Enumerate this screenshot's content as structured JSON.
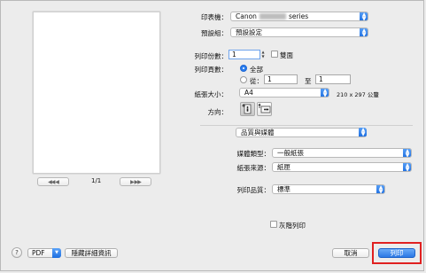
{
  "nav": {
    "prev_glyph": "◀◀ ◀",
    "next_glyph": "▶ ▶▶",
    "page_indicator": "1/1"
  },
  "printer": {
    "label": "印表機：",
    "value_prefix": "Canon",
    "value_suffix": "series"
  },
  "preset": {
    "label": "預設組：",
    "value": "預設設定"
  },
  "copies": {
    "label": "列印份數：",
    "value": "1",
    "duplex_label": "雙面"
  },
  "pages": {
    "label": "列印頁數：",
    "all_label": "全部",
    "from_label": "從：",
    "from_value": "1",
    "to_label": "至",
    "to_value": "1"
  },
  "paper_size": {
    "label": "紙張大小：",
    "value": "A4",
    "dims": "210 x 297 公釐"
  },
  "orientation": {
    "label": "方向："
  },
  "section": {
    "value": "品質與媒體"
  },
  "media_type": {
    "label": "媒體類型：",
    "value": "一般紙張"
  },
  "paper_source": {
    "label": "紙張來源：",
    "value": "紙匣"
  },
  "print_quality": {
    "label": "列印品質：",
    "value": "標準"
  },
  "grayscale": {
    "label": "灰階列印"
  },
  "bottom": {
    "help": "?",
    "pdf": "PDF",
    "hide_details": "隱藏詳細資訊",
    "cancel": "取消",
    "print": "列印"
  },
  "colors": {
    "accent": "#2b78e4",
    "highlight_frame": "#e02020"
  }
}
